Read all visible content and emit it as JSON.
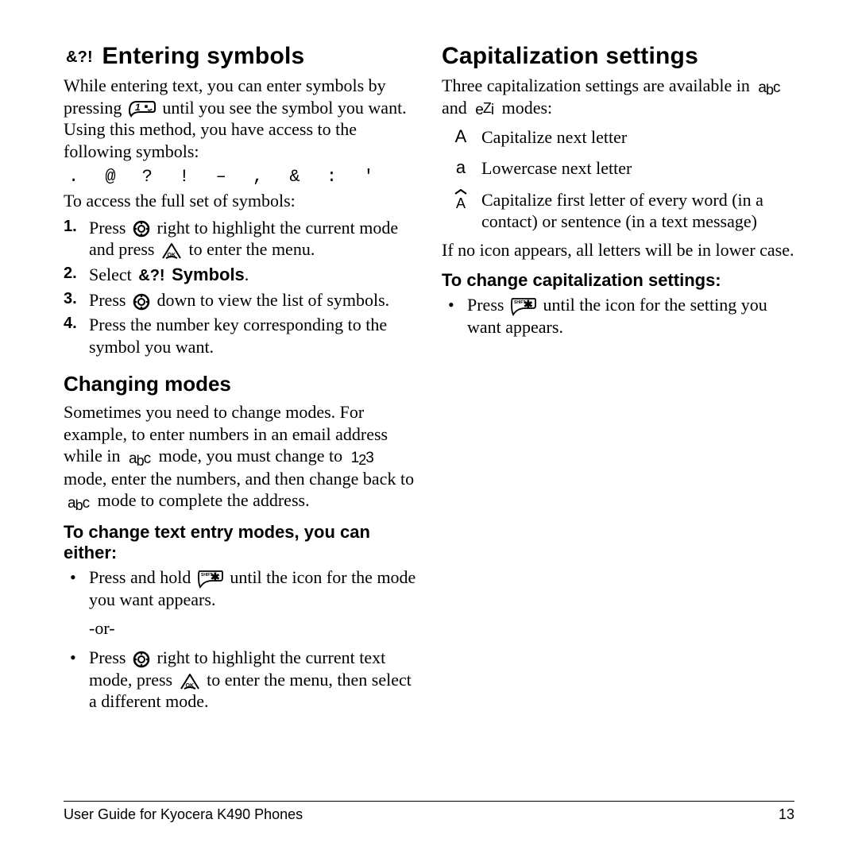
{
  "left": {
    "entering_symbols": {
      "icon_label": "&?!",
      "heading": "Entering symbols",
      "p1a": "While entering text, you can enter symbols by pressing ",
      "p1b": " until you see the symbol you want. Using this method, you have access to the following symbols:",
      "symbols_row": ".  @  ?  !  –  ,  &  :  '",
      "p2": "To access the full set of symbols:",
      "step1a": "Press ",
      "step1b": " right to highlight the current mode and press ",
      "step1c": " to enter the menu.",
      "step2a": "Select ",
      "step2_icon": "&?!",
      "step2b": " Symbols",
      "step2c": ".",
      "step3a": "Press ",
      "step3b": " down to view the list of symbols.",
      "step4": "Press the number key corresponding to the symbol you want."
    },
    "changing_modes": {
      "heading": "Changing modes",
      "p1a": "Sometimes you need to change modes. For example, to enter numbers in an email address while in ",
      "p1b": " mode, you must change to ",
      "p1c": " mode, enter the numbers, and then change back to ",
      "p1d": " mode to complete the address.",
      "sub_heading": "To change text entry modes, you can either:",
      "bullet1a": "Press and hold ",
      "bullet1b": " until the icon for the mode you want appears.",
      "or": "-or-",
      "bullet2a": "Press ",
      "bullet2b": " right to highlight the current text mode, press ",
      "bullet2c": " to enter the menu, then select a different mode."
    }
  },
  "right": {
    "capitalization": {
      "heading": "Capitalization settings",
      "p1a": "Three capitalization settings are available in ",
      "p1b": " and ",
      "p1c": " modes:",
      "row1": "Capitalize next letter",
      "row2": "Lowercase next letter",
      "row3": "Capitalize first letter of every word (in a contact) or sentence (in a text message)",
      "p2": "If no icon appears, all letters will be in lower case.",
      "sub_heading": "To change capitalization settings:",
      "bullet1a": "Press ",
      "bullet1b": " until the icon for the setting you want appears."
    }
  },
  "footer": {
    "left": "User Guide for Kyocera K490 Phones",
    "right": "13"
  },
  "inline_modes": {
    "abc_a": "a",
    "abc_b": "b",
    "abc_c": "c",
    "n1": "1",
    "n2": "2",
    "n3": "3",
    "ez_e": "e",
    "ez_z": "Z",
    "ez_i": "i",
    "capA": "A",
    "lowa": "a"
  }
}
